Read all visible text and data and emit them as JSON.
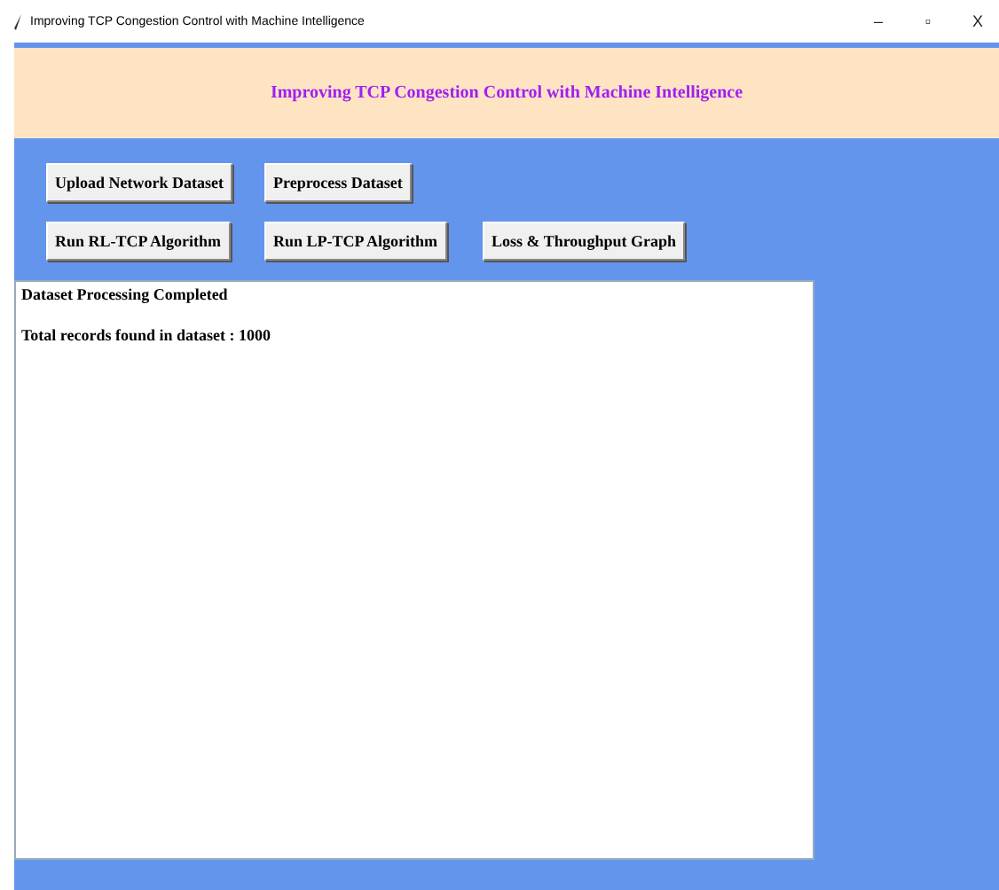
{
  "window": {
    "title": "Improving TCP Congestion Control with Machine Intelligence",
    "controls": [
      "–",
      "▫",
      "X"
    ]
  },
  "header": {
    "title": "Improving TCP Congestion Control with Machine Intelligence"
  },
  "button_rows": [
    [
      "Upload Network Dataset",
      "Preprocess Dataset"
    ],
    [
      "Run RL-TCP Algorithm",
      "Run LP-TCP Algorithm",
      "Loss & Throughput Graph"
    ]
  ],
  "output": {
    "lines": [
      "Dataset Processing Completed",
      "Total records found in dataset : 1000"
    ]
  }
}
